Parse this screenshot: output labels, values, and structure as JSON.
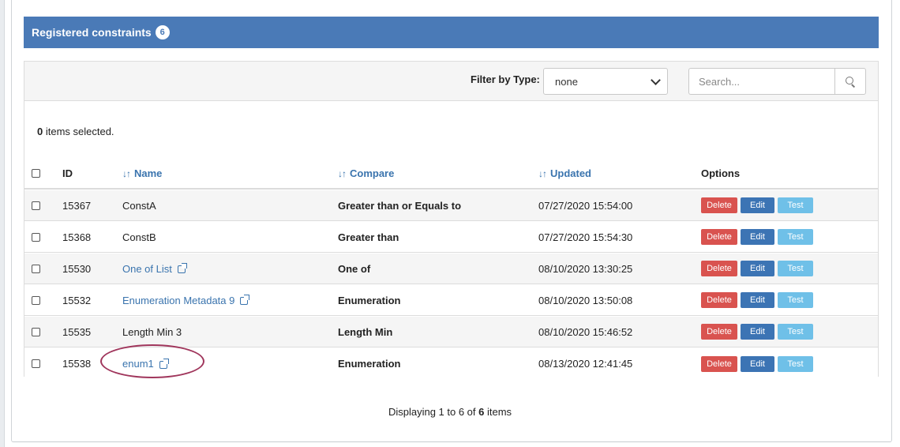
{
  "panel": {
    "title": "Registered constraints",
    "count": "6"
  },
  "toolbar": {
    "filter_label": "Filter by Type:",
    "filter_value": "none",
    "search_placeholder": "Search..."
  },
  "selection": {
    "count": "0",
    "suffix": " items selected."
  },
  "table": {
    "columns": {
      "id": "ID",
      "name": "Name",
      "compare": "Compare",
      "updated": "Updated",
      "options": "Options"
    },
    "rows": [
      {
        "id": "15367",
        "name": "ConstA",
        "name_link": false,
        "compare": "Greater than or Equals to",
        "updated": "07/27/2020 15:54:00"
      },
      {
        "id": "15368",
        "name": "ConstB",
        "name_link": false,
        "compare": "Greater than",
        "updated": "07/27/2020 15:54:30"
      },
      {
        "id": "15530",
        "name": "One of List",
        "name_link": true,
        "compare": "One of",
        "updated": "08/10/2020 13:30:25"
      },
      {
        "id": "15532",
        "name": "Enumeration Metadata 9",
        "name_link": true,
        "compare": "Enumeration",
        "updated": "08/10/2020 13:50:08"
      },
      {
        "id": "15535",
        "name": "Length Min 3",
        "name_link": false,
        "compare": "Length Min",
        "updated": "08/10/2020 15:46:52"
      },
      {
        "id": "15538",
        "name": "enum1",
        "name_link": true,
        "compare": "Enumeration",
        "updated": "08/13/2020 12:41:45"
      }
    ],
    "actions": {
      "delete": "Delete",
      "edit": "Edit",
      "test": "Test"
    }
  },
  "footer": {
    "prefix": "Displaying 1 to 6 of ",
    "total": "6",
    "suffix": " items"
  },
  "colors": {
    "header_bg": "#4a7ab7",
    "link": "#3a74ae",
    "delete": "#d9534f",
    "edit": "#3c74b4",
    "test": "#6fc0e8",
    "annotation": "#a0365c"
  },
  "icons": {
    "sort": "sort-arrows-icon",
    "external": "external-link-icon",
    "search": "magnifier-icon",
    "dropdown": "chevron-down-icon"
  }
}
